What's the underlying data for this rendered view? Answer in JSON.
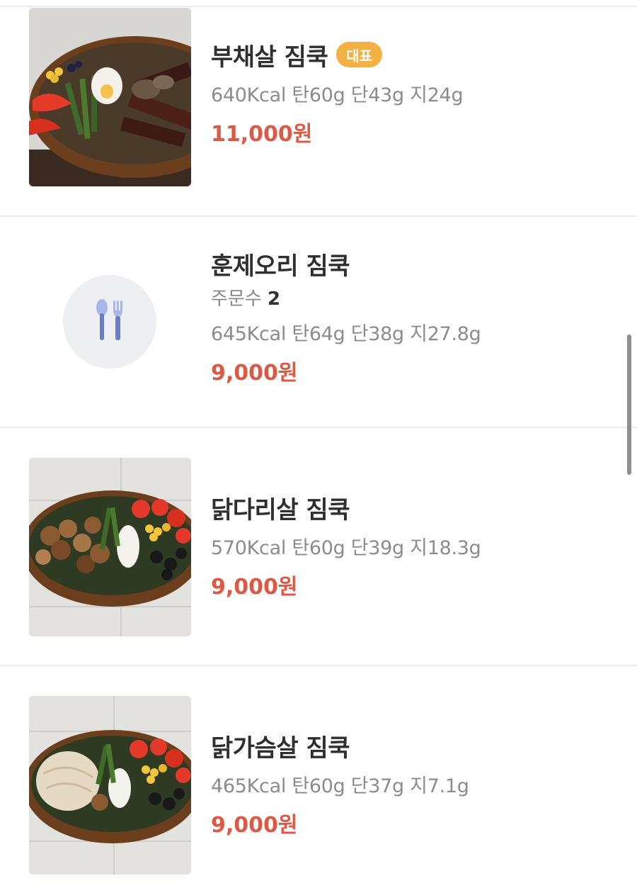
{
  "menu": [
    {
      "name": "부채살 짐쿡",
      "badge": "대표",
      "nutrition": "640Kcal 탄60g 단43g 지24g",
      "price": "11,000원"
    },
    {
      "name": "훈제오리 짐쿡",
      "orders_label": "주문수",
      "orders_count": "2",
      "nutrition": "645Kcal 탄64g 단38g 지27.8g",
      "price": "9,000원"
    },
    {
      "name": "닭다리살 짐쿡",
      "nutrition": "570Kcal 탄60g 단39g 지18.3g",
      "price": "9,000원"
    },
    {
      "name": "닭가슴살 짐쿡",
      "nutrition": "465Kcal 탄60g 단37g 지7.1g",
      "price": "9,000원"
    }
  ],
  "icons": {
    "placeholder": "spoon-fork-icon"
  },
  "colors": {
    "price": "#dc5a45",
    "badge": "#f3b143",
    "divider": "#ececec"
  }
}
